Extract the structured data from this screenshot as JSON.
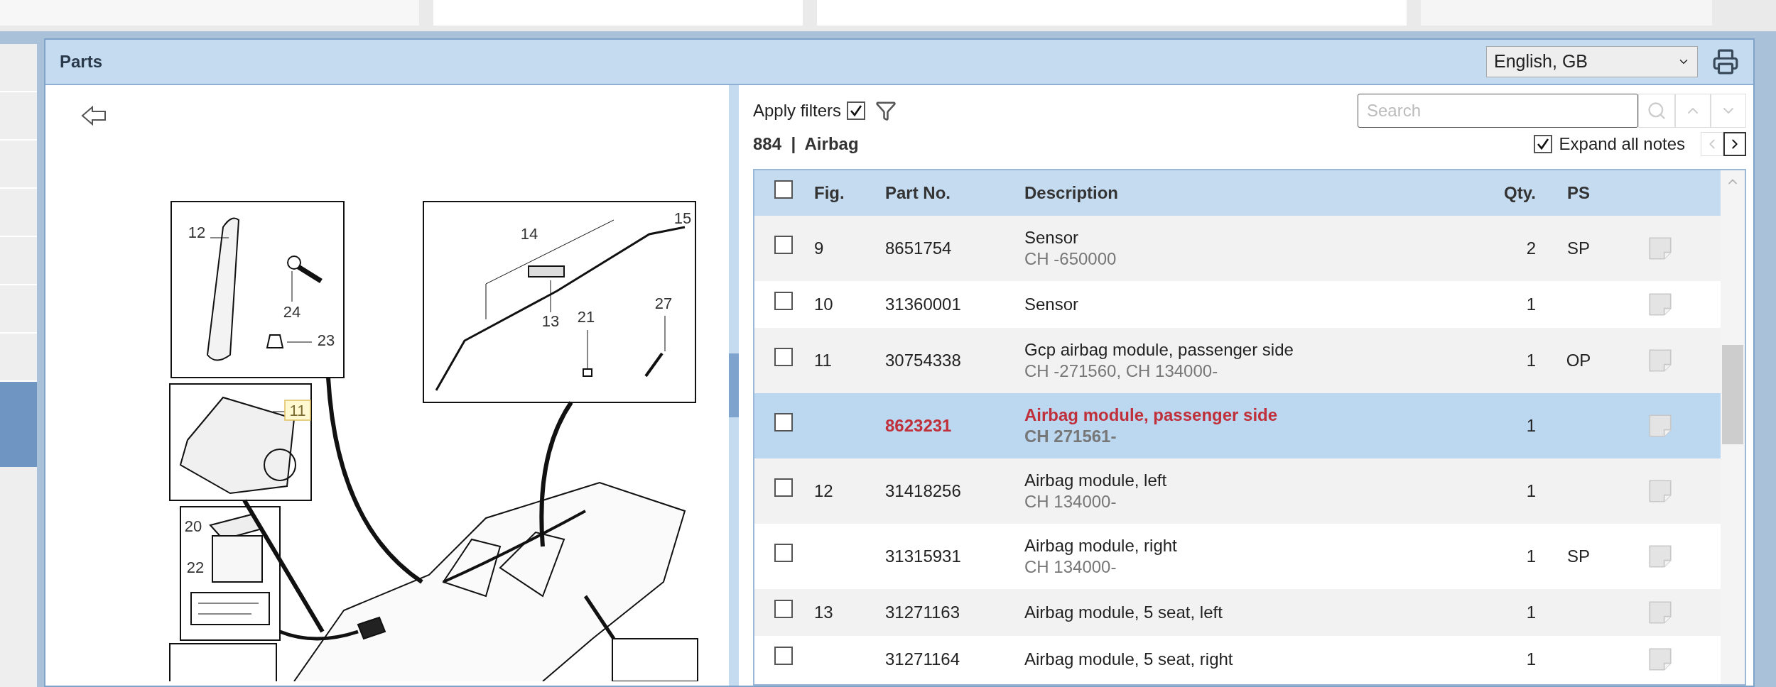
{
  "panel": {
    "title": "Parts",
    "language": "English, GB"
  },
  "filters": {
    "label": "Apply filters",
    "checked": true
  },
  "search": {
    "placeholder": "Search"
  },
  "group": {
    "number": "884",
    "separator": "|",
    "name": "Airbag"
  },
  "expand_notes": {
    "label": "Expand all notes",
    "checked": true
  },
  "table": {
    "columns": [
      "Fig.",
      "Part No.",
      "Description",
      "Qty.",
      "PS"
    ],
    "select_all_checked": false,
    "rows": [
      {
        "fig": "9",
        "part_no": "8651754",
        "description": "Sensor",
        "note": "CH -650000",
        "qty": "2",
        "ps": "SP",
        "checked": false,
        "selected": false
      },
      {
        "fig": "10",
        "part_no": "31360001",
        "description": "Sensor",
        "qty": "1",
        "checked": false,
        "selected": false
      },
      {
        "fig": "11",
        "part_no": "30754338",
        "description": "Gcp airbag module, passenger side",
        "note": "CH -271560, CH 134000-",
        "qty": "1",
        "ps": "OP",
        "checked": false,
        "selected": false
      },
      {
        "part_no": "8623231",
        "description": "Airbag module, passenger side",
        "note": "CH 271561-",
        "qty": "1",
        "checked": false,
        "selected": true
      },
      {
        "fig": "12",
        "part_no": "31418256",
        "description": "Airbag module, left",
        "note": "CH 134000-",
        "qty": "1",
        "checked": false,
        "selected": false
      },
      {
        "part_no": "31315931",
        "description": "Airbag module, right",
        "note": "CH 134000-",
        "qty": "1",
        "ps": "SP",
        "checked": false,
        "selected": false
      },
      {
        "fig": "13",
        "part_no": "31271163",
        "description": "Airbag module, 5 seat, left",
        "qty": "1",
        "checked": false,
        "selected": false
      },
      {
        "part_no": "31271164",
        "description": "Airbag module, 5 seat, right",
        "qty": "1",
        "checked": false,
        "selected": false
      }
    ]
  },
  "diagram": {
    "callouts": [
      {
        "label": "12",
        "highlighted": false
      },
      {
        "label": "24",
        "highlighted": false
      },
      {
        "label": "23",
        "highlighted": false
      },
      {
        "label": "14",
        "highlighted": false
      },
      {
        "label": "15",
        "highlighted": false
      },
      {
        "label": "13",
        "highlighted": false
      },
      {
        "label": "21",
        "highlighted": false
      },
      {
        "label": "27",
        "highlighted": false
      },
      {
        "label": "11",
        "highlighted": true
      },
      {
        "label": "20",
        "highlighted": false
      },
      {
        "label": "22",
        "highlighted": false
      }
    ]
  }
}
